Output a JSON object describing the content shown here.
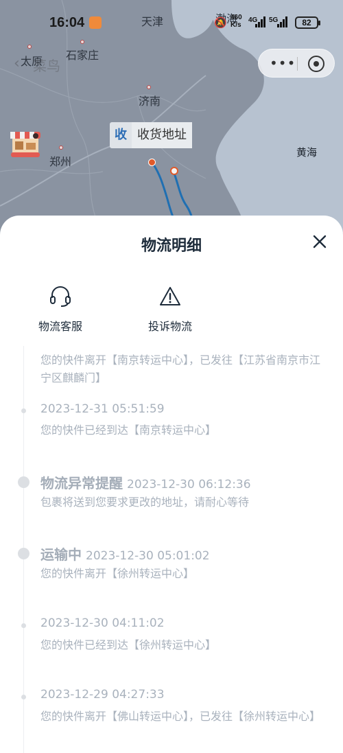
{
  "status_bar": {
    "time": "16:04",
    "network_speed_top": "460",
    "network_speed_unit": "K/s",
    "net_4g": "4G",
    "net_5g": "5G",
    "battery": "82"
  },
  "map": {
    "back_text": "菜鸟",
    "cities": [
      "天津",
      "渤海",
      "太原",
      "石家庄",
      "济南",
      "郑州"
    ],
    "sea": "黄海",
    "address_tag": {
      "badge": "收",
      "label": "收货地址"
    }
  },
  "sheet": {
    "title": "物流明细",
    "actions": [
      {
        "label": "物流客服",
        "icon": "headset-icon"
      },
      {
        "label": "投诉物流",
        "icon": "warning-icon"
      }
    ],
    "events": [
      {
        "status": "",
        "time": "",
        "desc": "您的快件离开【南京转运中心】，已发往【江苏省南京市江宁区麒麟门】"
      },
      {
        "status": "",
        "time": "2023-12-31 05:51:59",
        "desc": "您的快件已经到达【南京转运中心】"
      },
      {
        "status": "物流异常提醒",
        "time": "2023-12-30 06:12:36",
        "desc": "包裹将送到您要求更改的地址，请耐心等待"
      },
      {
        "status": "运输中",
        "time": "2023-12-30 05:01:02",
        "desc": "您的快件离开【徐州转运中心】"
      },
      {
        "status": "",
        "time": "2023-12-30 04:11:02",
        "desc": "您的快件已经到达【徐州转运中心】"
      },
      {
        "status": "",
        "time": "2023-12-29 04:27:33",
        "desc": "您的快件离开【佛山转运中心】，已发往【徐州转运中心】"
      }
    ]
  },
  "colors": {
    "route": "#1f6fb2",
    "origin_marker": "#e05a2a",
    "timeline_text": "#a9b2bd",
    "title_text": "#1d2b3a"
  }
}
